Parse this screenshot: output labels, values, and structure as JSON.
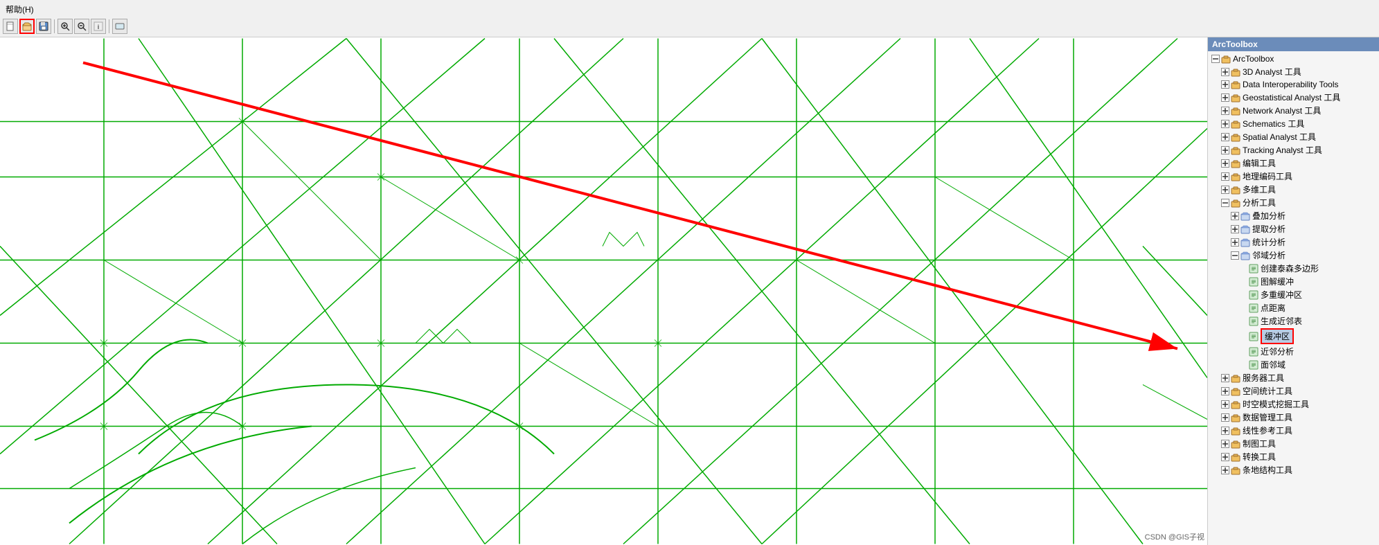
{
  "toolbar": {
    "menu_items": [
      "帮助(H)"
    ],
    "buttons": [
      "new",
      "open",
      "save",
      "zoomin",
      "zoomout",
      "pan",
      "identify"
    ]
  },
  "panel": {
    "title": "ArcToolbox",
    "tree": [
      {
        "id": "arctoolbox-root",
        "label": "ArcToolbox",
        "indent": 0,
        "expand": "minus",
        "icon": "folder",
        "selected": false
      },
      {
        "id": "3d-analyst",
        "label": "3D Analyst 工具",
        "indent": 1,
        "expand": "plus",
        "icon": "toolbox",
        "selected": false
      },
      {
        "id": "data-interop",
        "label": "Data Interoperability Tools",
        "indent": 1,
        "expand": "plus",
        "icon": "toolbox",
        "selected": false
      },
      {
        "id": "geostatistical",
        "label": "Geostatistical Analyst 工具",
        "indent": 1,
        "expand": "plus",
        "icon": "toolbox",
        "selected": false
      },
      {
        "id": "network-analyst",
        "label": "Network Analyst 工具",
        "indent": 1,
        "expand": "plus",
        "icon": "toolbox",
        "selected": false
      },
      {
        "id": "schematics",
        "label": "Schematics 工具",
        "indent": 1,
        "expand": "plus",
        "icon": "toolbox",
        "selected": false
      },
      {
        "id": "spatial-analyst",
        "label": "Spatial Analyst 工具",
        "indent": 1,
        "expand": "plus",
        "icon": "toolbox",
        "selected": false
      },
      {
        "id": "tracking-analyst",
        "label": "Tracking Analyst 工具",
        "indent": 1,
        "expand": "plus",
        "icon": "toolbox",
        "selected": false
      },
      {
        "id": "edit-tools",
        "label": "编辑工具",
        "indent": 1,
        "expand": "plus",
        "icon": "toolbox",
        "selected": false
      },
      {
        "id": "geo-encode",
        "label": "地理编码工具",
        "indent": 1,
        "expand": "plus",
        "icon": "toolbox",
        "selected": false
      },
      {
        "id": "multi-tools",
        "label": "多维工具",
        "indent": 1,
        "expand": "plus",
        "icon": "toolbox",
        "selected": false
      },
      {
        "id": "analysis-tools",
        "label": "分析工具",
        "indent": 1,
        "expand": "minus",
        "icon": "toolbox",
        "selected": false
      },
      {
        "id": "overlay-analysis",
        "label": "叠加分析",
        "indent": 2,
        "expand": "plus",
        "icon": "toolgroup",
        "selected": false
      },
      {
        "id": "extract-analysis",
        "label": "提取分析",
        "indent": 2,
        "expand": "plus",
        "icon": "toolgroup",
        "selected": false
      },
      {
        "id": "stat-analysis",
        "label": "统计分析",
        "indent": 2,
        "expand": "plus",
        "icon": "toolgroup",
        "selected": false
      },
      {
        "id": "neighbor-analysis",
        "label": "邻域分析",
        "indent": 2,
        "expand": "minus",
        "icon": "toolgroup",
        "selected": false
      },
      {
        "id": "thiessen",
        "label": "创建泰森多边形",
        "indent": 3,
        "expand": "none",
        "icon": "tool",
        "selected": false
      },
      {
        "id": "graph-buffer",
        "label": "图解缓冲",
        "indent": 3,
        "expand": "none",
        "icon": "tool",
        "selected": false
      },
      {
        "id": "multi-buffer",
        "label": "多重缓冲区",
        "indent": 3,
        "expand": "none",
        "icon": "tool",
        "selected": false
      },
      {
        "id": "point-distance",
        "label": "点距离",
        "indent": 3,
        "expand": "none",
        "icon": "tool",
        "selected": false
      },
      {
        "id": "generate-near",
        "label": "生成近邻表",
        "indent": 3,
        "expand": "none",
        "icon": "tool",
        "selected": false
      },
      {
        "id": "buffer-zone",
        "label": "缓冲区",
        "indent": 3,
        "expand": "none",
        "icon": "tool",
        "selected": true,
        "highlighted": true
      },
      {
        "id": "near-analysis",
        "label": "近邻分析",
        "indent": 3,
        "expand": "none",
        "icon": "tool",
        "selected": false
      },
      {
        "id": "polygon-neighbor",
        "label": "面邻域",
        "indent": 3,
        "expand": "none",
        "icon": "tool",
        "selected": false
      },
      {
        "id": "server-tools",
        "label": "服务器工具",
        "indent": 1,
        "expand": "plus",
        "icon": "toolbox",
        "selected": false
      },
      {
        "id": "spatial-stat",
        "label": "空间统计工具",
        "indent": 1,
        "expand": "plus",
        "icon": "toolbox",
        "selected": false
      },
      {
        "id": "spacetime-mining",
        "label": "时空模式挖掘工具",
        "indent": 1,
        "expand": "plus",
        "icon": "toolbox",
        "selected": false
      },
      {
        "id": "data-manage",
        "label": "数据管理工具",
        "indent": 1,
        "expand": "plus",
        "icon": "toolbox",
        "selected": false
      },
      {
        "id": "linear-ref",
        "label": "线性参考工具",
        "indent": 1,
        "expand": "plus",
        "icon": "toolbox",
        "selected": false
      },
      {
        "id": "cartography",
        "label": "制图工具",
        "indent": 1,
        "expand": "plus",
        "icon": "toolbox",
        "selected": false
      },
      {
        "id": "conversion",
        "label": "转换工具",
        "indent": 1,
        "expand": "plus",
        "icon": "toolbox",
        "selected": false
      },
      {
        "id": "terrain",
        "label": "条地结构工具",
        "indent": 1,
        "expand": "plus",
        "icon": "toolbox",
        "selected": false
      }
    ]
  },
  "watermark": "CSDN @GIS子视",
  "arrow": {
    "x1_pct": 8,
    "y1_pct": 5,
    "x2_pct": 98,
    "y2_pct": 62
  }
}
